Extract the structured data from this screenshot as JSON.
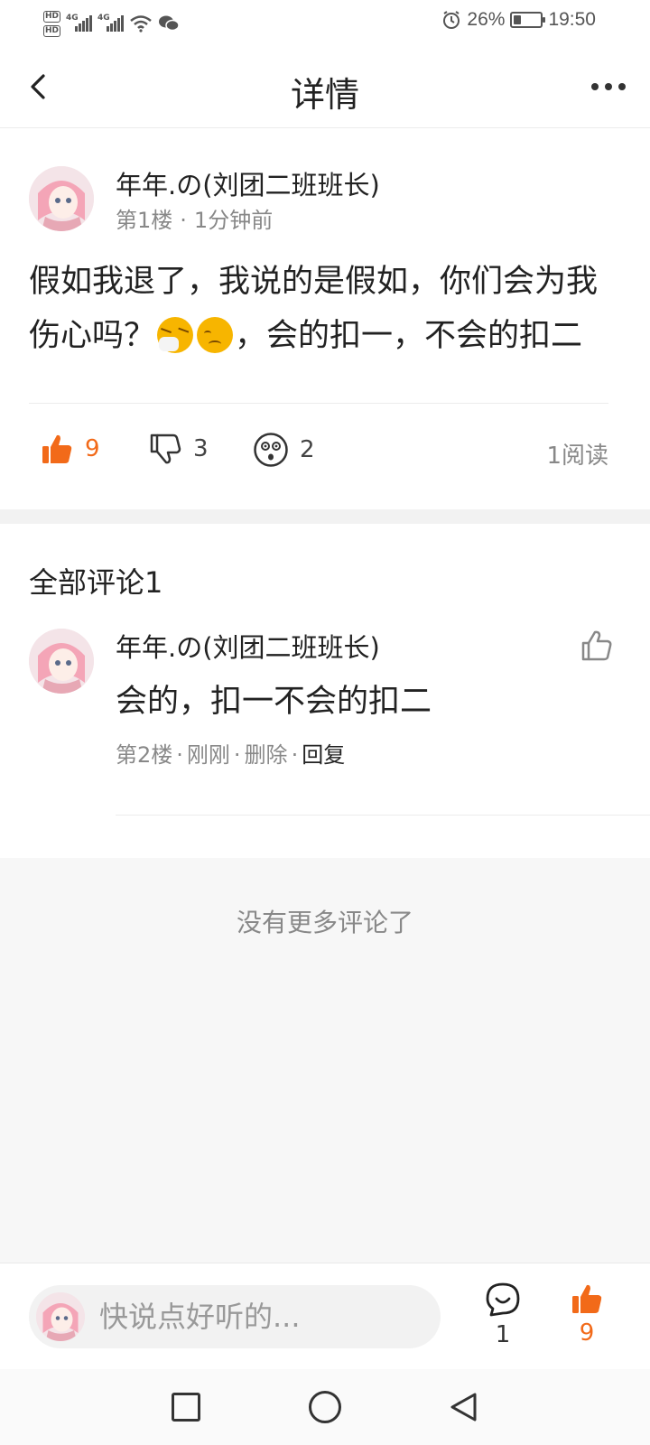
{
  "status_bar": {
    "hd1": "HD",
    "hd2": "HD",
    "net1": "4G",
    "net2": "4G",
    "battery_percent": "26%",
    "battery_level": 0.26,
    "time": "19:50"
  },
  "header": {
    "title": "详情"
  },
  "post": {
    "author": "年年.の(刘团二班班长)",
    "floor": "第1楼",
    "time": "1分钟前",
    "text_part1": "假如我退了，我说的是假如，你们会为我伤心吗？",
    "emojis": [
      "sneezing-face-emoji",
      "disappointed-face-emoji"
    ],
    "text_part2": "，会的扣一，不会的扣二",
    "likes": "9",
    "dislikes": "3",
    "surprised": "2",
    "reads": "1阅读"
  },
  "comments": {
    "header": "全部评论1",
    "items": [
      {
        "author": "年年.の(刘团二班班长)",
        "text": "会的，扣一不会的扣二",
        "floor": "第2楼",
        "time": "刚刚",
        "delete": "删除",
        "reply": "回复"
      }
    ],
    "no_more": "没有更多评论了"
  },
  "bottom_bar": {
    "input_placeholder": "快说点好听的...",
    "comment_count": "1",
    "like_count": "9"
  },
  "colors": {
    "accent": "#f26a19",
    "text": "#222222",
    "muted": "#888888",
    "background_muted": "#f7f7f7"
  }
}
